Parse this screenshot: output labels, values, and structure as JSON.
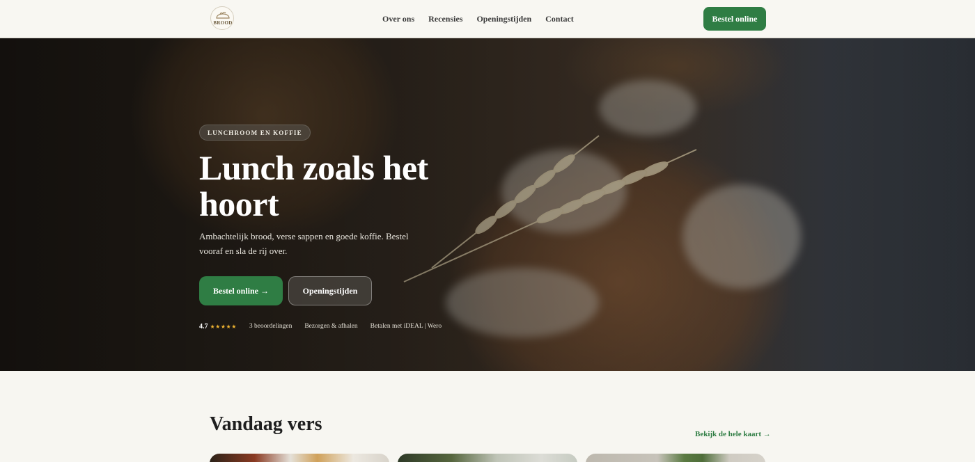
{
  "header": {
    "logo_text": "BROOD",
    "nav": [
      "Over ons",
      "Recensies",
      "Openingstijden",
      "Contact"
    ],
    "order_button": "Bestel online"
  },
  "hero": {
    "badge": "LUNCHROOM EN KOFFIE",
    "title": "Lunch zoals het hoort",
    "subtitle": "Ambachtelijk brood, verse sappen en goede koffie. Bestel vooraf en sla de rij over.",
    "primary_button": "Bestel online →",
    "secondary_button": "Openingstijden",
    "rating": "4.7",
    "stars": "★★★★★",
    "trust_items": [
      "3 beoordelingen",
      "Bezorgen & afhalen",
      "Betalen met iDEAL | Wero"
    ]
  },
  "section": {
    "title": "Vandaag vers",
    "link": "Bekijk de hele kaart →"
  },
  "colors": {
    "accent": "#2f7d44",
    "star": "#f2b632",
    "background": "#f7f6f1"
  }
}
